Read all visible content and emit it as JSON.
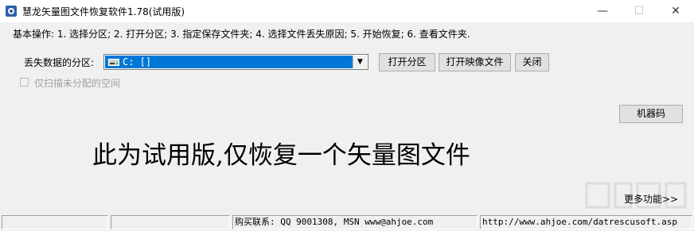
{
  "window": {
    "title": "慧龙矢量图文件恢复软件1.78(试用版)",
    "minimize_glyph": "—",
    "maximize_glyph": "☐",
    "close_glyph": "✕"
  },
  "steps_text": "基本操作: 1. 选择分区; 2. 打开分区; 3. 指定保存文件夹; 4. 选择文件丢失原因; 5. 开始恢复; 6. 查看文件夹.",
  "partition": {
    "label": "丢失数据的分区:",
    "selected": "C: []",
    "drive_icon": "drive-icon",
    "arrow_glyph": "▼"
  },
  "buttons": {
    "open_partition": "打开分区",
    "open_image": "打开映像文件",
    "close": "关闭",
    "machine_code": "机器码"
  },
  "checkbox": {
    "label": "仅扫描未分配的空间",
    "checked": false
  },
  "trial_banner": "此为试用版,仅恢复一个矢量图文件",
  "more_link": "更多功能>>",
  "statusbar": {
    "pane1": "",
    "pane2": "",
    "contact": "购买联系: QQ 9001308, MSN www@ahjoe.com",
    "url": "http://www.ahjoe.com/datrescusoft.asp"
  },
  "colors": {
    "selection": "#0078d7",
    "background": "#f0f0f0"
  }
}
